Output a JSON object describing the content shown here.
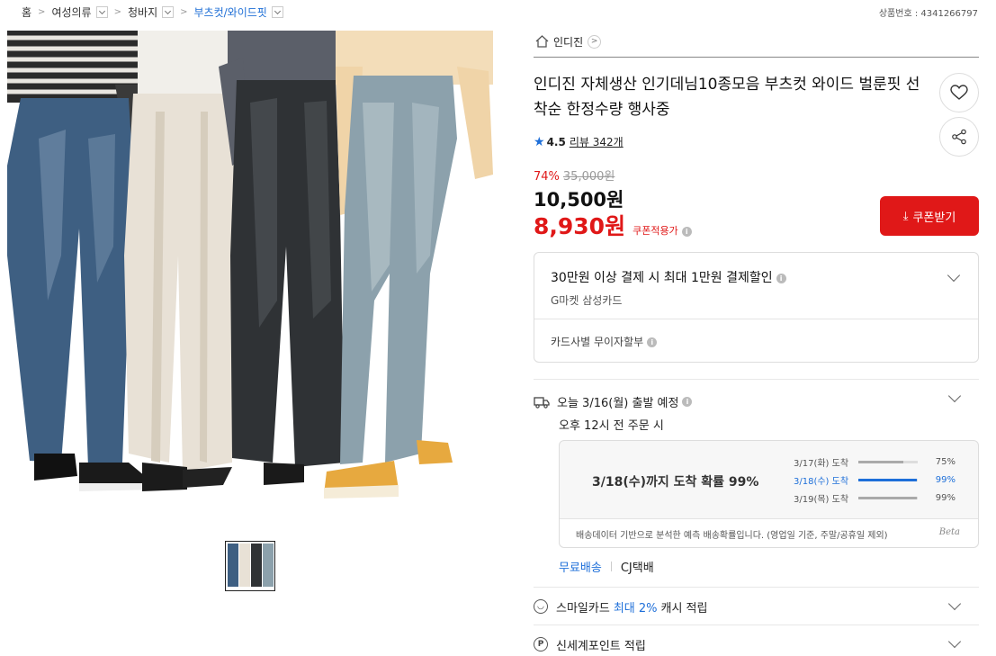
{
  "breadcrumb": [
    {
      "label": "홈",
      "dropdown": false
    },
    {
      "label": "여성의류",
      "dropdown": true
    },
    {
      "label": "청바지",
      "dropdown": true
    },
    {
      "label": "부츠컷/와이드핏",
      "dropdown": true
    }
  ],
  "product_number": "상품번호 : 4341266797",
  "shop_name": "인디진",
  "title": "인디진 자체생산 인기데님10종모음 부츠컷 와이드 벌룬핏 선착순 한정수량 행사중",
  "rating": {
    "score": "4.5",
    "review_label": "리뷰 342개"
  },
  "discount_rate": "74%",
  "original_price": "35,000원",
  "price": "10,500원",
  "coupon_price": "8,930원",
  "coupon_applied_label": "쿠폰적용가",
  "coupon_button": "쿠폰받기",
  "payment": {
    "benefit": "30만원 이상 결제 시 최대 1만원 결제할인",
    "card": "G마켓 삼성카드",
    "installment": "카드사별 무이자할부"
  },
  "shipping": {
    "departure": "오늘 3/16(월) 출발 예정",
    "condition": "오후 12시 전 주문 시",
    "arrival_headline": "3/18(수)까지 도착 확률 99%",
    "arrival_rows": [
      {
        "label": "3/17(화) 도착",
        "percent": "75%",
        "value": 0.75,
        "highlight": false
      },
      {
        "label": "3/18(수) 도착",
        "percent": "99%",
        "value": 0.99,
        "highlight": true
      },
      {
        "label": "3/19(목) 도착",
        "percent": "99%",
        "value": 0.99,
        "highlight": false
      }
    ],
    "note": "배송데이터 기반으로 분석한 예측 배송확률입니다. (영업일 기준, 주말/공휴일 제외)",
    "beta": "Beta",
    "fee": "무료배송",
    "courier": "CJ택배"
  },
  "smile": {
    "prefix": "스마일카드",
    "highlight": "최대 2%",
    "suffix": "캐시 적립"
  },
  "shinsegae": "신세계포인트 적립",
  "colors": {
    "red": "#e01818",
    "blue": "#1e6fd9"
  }
}
